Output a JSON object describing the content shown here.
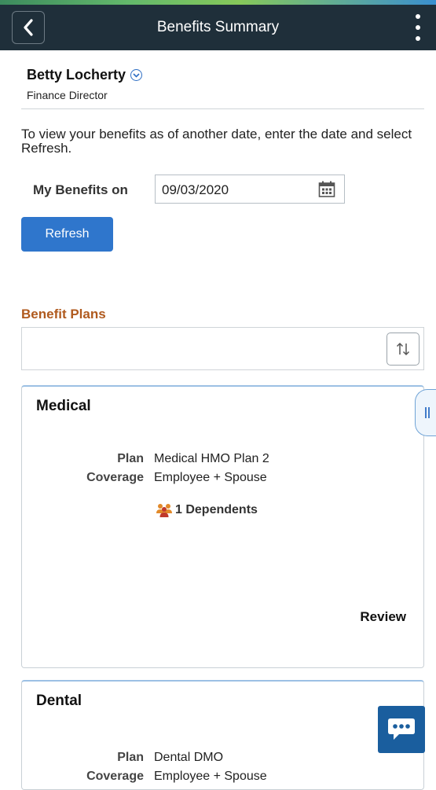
{
  "header": {
    "title": "Benefits Summary"
  },
  "employee": {
    "name": "Betty Locherty",
    "job_title": "Finance Director"
  },
  "intro_text": "To view your benefits as of another date, enter the date and select Refresh.",
  "date_filter": {
    "label": "My Benefits on",
    "value": "09/03/2020"
  },
  "refresh_label": "Refresh",
  "benefit_plans_title": "Benefit Plans",
  "plans": [
    {
      "name": "Medical",
      "plan_label": "Plan",
      "plan_value": "Medical HMO Plan 2",
      "coverage_label": "Coverage",
      "coverage_value": "Employee + Spouse",
      "dependents": "1 Dependents",
      "action": "Review"
    },
    {
      "name": "Dental",
      "plan_label": "Plan",
      "plan_value": "Dental DMO",
      "coverage_label": "Coverage",
      "coverage_value": "Employee + Spouse"
    }
  ],
  "icons": {
    "back": "chevron-left-icon",
    "menu": "kebab-menu-icon",
    "expand": "chevron-down-circle-icon",
    "calendar": "calendar-icon",
    "sort": "sort-arrows-icon",
    "dependents": "people-icon",
    "side_tab": "pause-tab-icon",
    "chat": "chat-bubble-icon"
  },
  "colors": {
    "header_bg": "#1f2f3a",
    "primary_button": "#2f76cc",
    "section_title": "#b05a1e",
    "chat_button": "#1a5e9e"
  }
}
